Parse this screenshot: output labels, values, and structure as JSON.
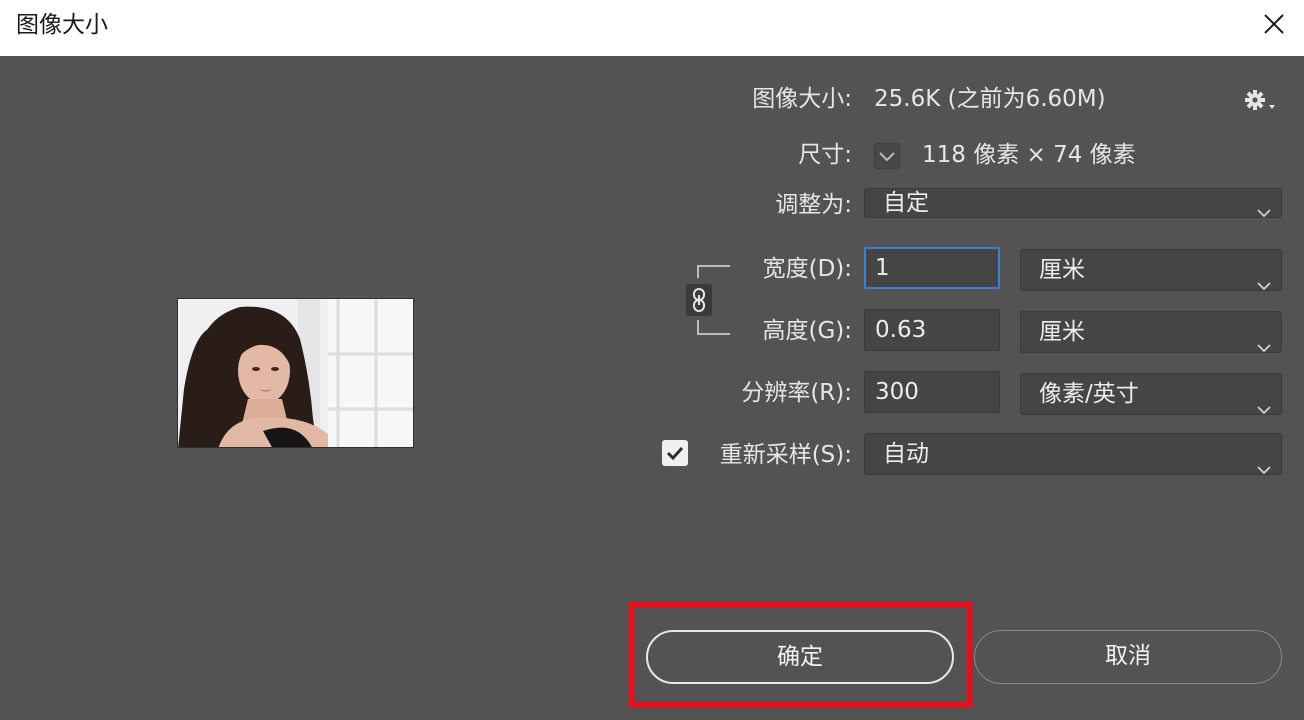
{
  "window": {
    "title": "图像大小"
  },
  "info": {
    "size_label": "图像大小:",
    "size_value": "25.6K (之前为6.60M)",
    "dim_label": "尺寸:",
    "dim_value": "118 像素 × 74 像素"
  },
  "fit": {
    "label": "调整为:",
    "value": "自定"
  },
  "width": {
    "label": "宽度(D):",
    "value": "1",
    "unit": "厘米"
  },
  "height": {
    "label": "高度(G):",
    "value": "0.63",
    "unit": "厘米"
  },
  "resolution": {
    "label": "分辨率(R):",
    "value": "300",
    "unit": "像素/英寸"
  },
  "resample": {
    "label": "重新采样(S):",
    "checked": true,
    "value": "自动"
  },
  "buttons": {
    "ok": "确定",
    "cancel": "取消"
  },
  "icons": {
    "close": "close-icon",
    "settings": "gear-icon",
    "link": "chain-link-icon",
    "dropdown": "chevron-down-icon"
  },
  "colors": {
    "background": "#535353",
    "focus": "#3d7fd8",
    "highlight": "#e0121d"
  }
}
